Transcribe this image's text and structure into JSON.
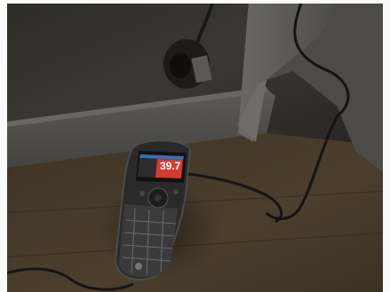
{
  "scene": {
    "meter_display": {
      "reading": "39.7",
      "screen_color": "#d33b2e",
      "header_color": "#3a6fb2"
    },
    "colors": {
      "wall": "#35332f",
      "floor": "#4a3d2c",
      "baseboard": "#5a5853",
      "frame": "#fafafa"
    }
  }
}
